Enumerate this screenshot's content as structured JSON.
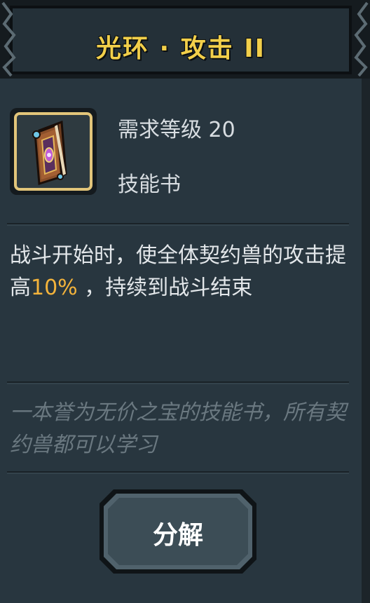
{
  "header": {
    "title": "光环 · 攻击 II"
  },
  "item": {
    "icon": "skill-book-icon",
    "required_level": "需求等级 20",
    "type": "技能书"
  },
  "description": {
    "before": "战斗开始时，使全体契约兽的攻击提高",
    "highlight": "10%",
    "after": " ，持续到战斗结束",
    "highlight_color": "#f3b33b"
  },
  "flavor_text": "一本誉为无价之宝的技能书，所有契约兽都可以学习",
  "actions": {
    "decompose_label": "分解"
  },
  "colors": {
    "title": "#f2cf4a",
    "panel": "#28363f",
    "icon_frame": "#e2c57a"
  }
}
